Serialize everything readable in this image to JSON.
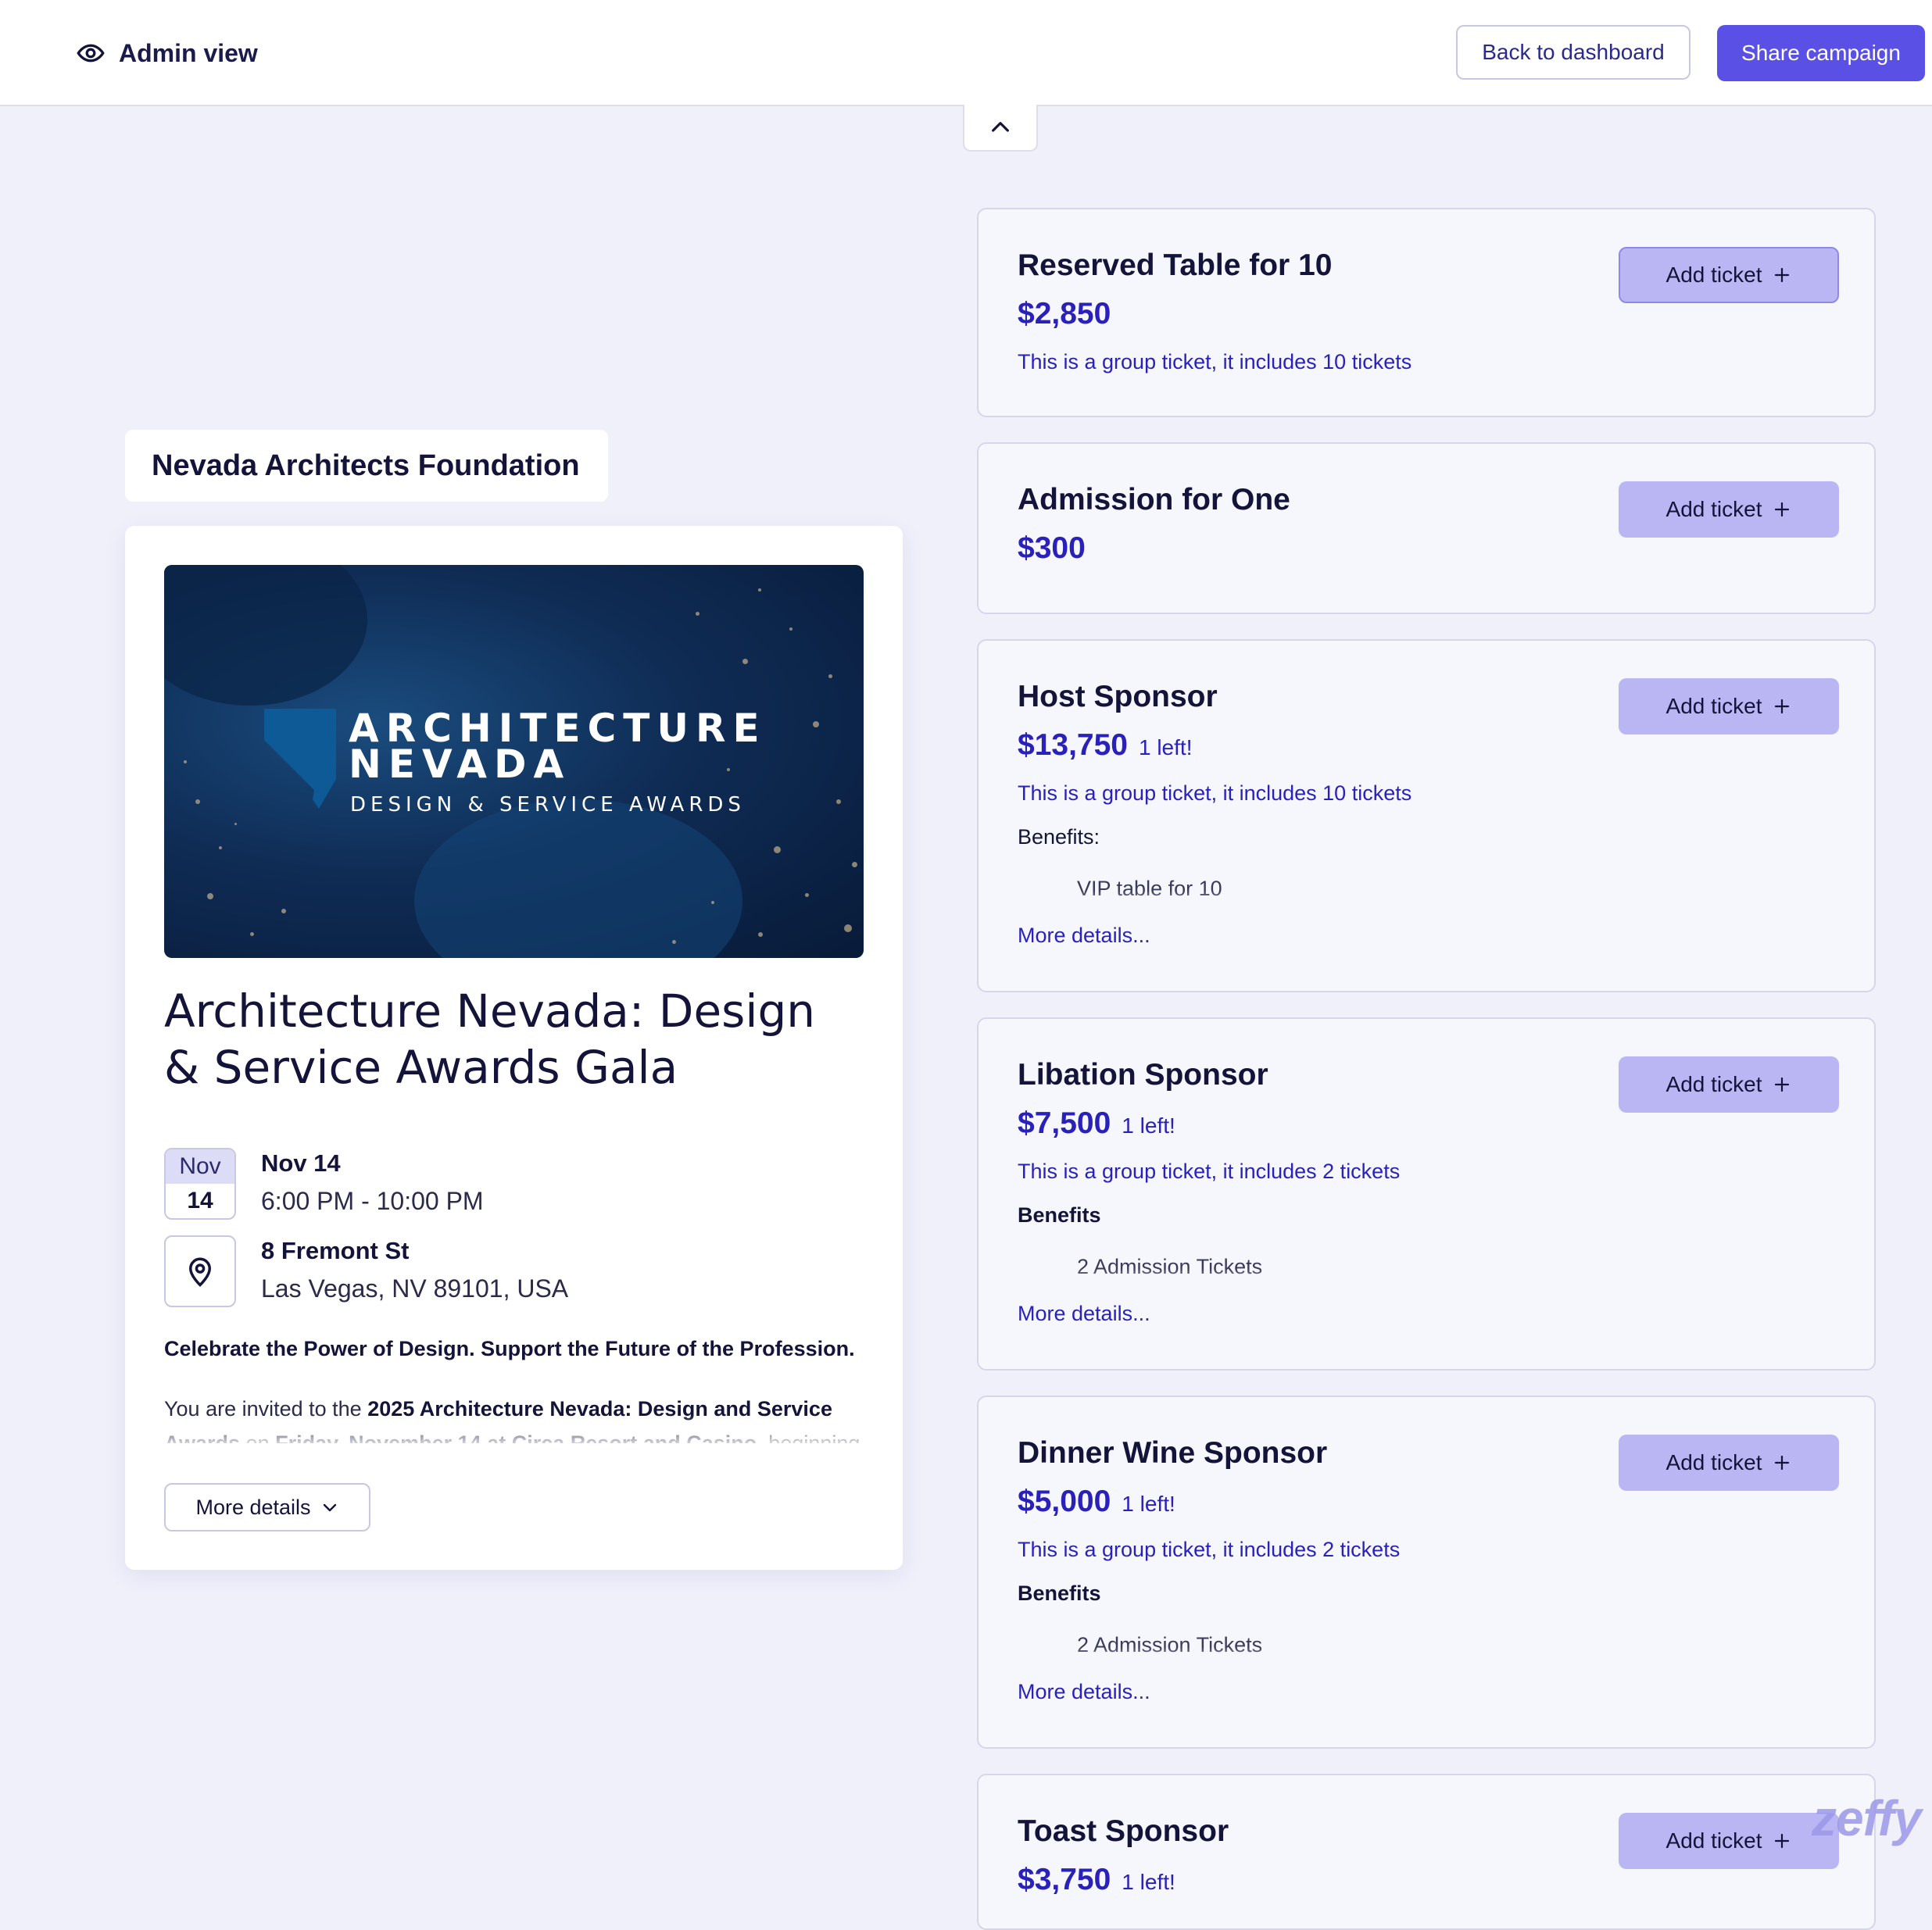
{
  "header": {
    "admin_label": "Admin view",
    "back_label": "Back to dashboard",
    "share_label": "Share campaign"
  },
  "organization": {
    "name": "Nevada Architects Foundation"
  },
  "event": {
    "banner": {
      "line1": "ARCHITECTURE",
      "line2": "NEVADA",
      "line3": "DESIGN & SERVICE AWARDS"
    },
    "title": "Architecture Nevada: Design & Service Awards Gala",
    "date_month": "Nov",
    "date_day": "14",
    "date_label": "Nov 14",
    "time_label": "6:00 PM - 10:00 PM",
    "address_line1": "8 Fremont St",
    "address_line2": "Las Vegas, NV 89101, USA",
    "tagline": "Celebrate the Power of Design. Support the Future of the Profession.",
    "description": {
      "t1": "You are invited to the ",
      "b1": "2025 Architecture Nevada: Design and Service Awards",
      "t2": " on ",
      "b2": "Friday, November 14 at Circa Resort and Casino",
      "t3": ", beginning"
    },
    "more_details_label": "More details"
  },
  "tickets": [
    {
      "name": "Reserved Table for 10",
      "price": "$2,850",
      "left": "",
      "note": "This is a group ticket, it includes 10 tickets",
      "add_label": "Add ticket"
    },
    {
      "name": "Admission for One",
      "price": "$300",
      "left": "",
      "note": "",
      "add_label": "Add ticket"
    },
    {
      "name": "Host Sponsor",
      "price": "$13,750",
      "left": "1 left!",
      "note": "This is a group ticket, it includes 10 tickets",
      "benefits_label": "Benefits:",
      "benefit": "VIP table for 10",
      "more": "More details...",
      "add_label": "Add ticket"
    },
    {
      "name": "Libation Sponsor",
      "price": "$7,500",
      "left": "1 left!",
      "note": "This is a group ticket, it includes 2 tickets",
      "benefits_label": "Benefits",
      "benefit": "2 Admission Tickets",
      "more": "More details...",
      "add_label": "Add ticket"
    },
    {
      "name": "Dinner Wine Sponsor",
      "price": "$5,000",
      "left": "1 left!",
      "note": "This is a group ticket, it includes 2 tickets",
      "benefits_label": "Benefits",
      "benefit": "2 Admission Tickets",
      "more": "More details...",
      "add_label": "Add ticket"
    },
    {
      "name": "Toast Sponsor",
      "price": "$3,750",
      "left": "1 left!",
      "add_label": "Add ticket"
    }
  ],
  "branding": {
    "watermark": "zeffy"
  },
  "icons": {
    "admin": "eye-icon",
    "collapse": "chevron-up-icon",
    "location": "map-pin-icon",
    "more": "chevron-down-icon",
    "add": "plus-icon"
  },
  "colors": {
    "page_bg": "#f0f0fb",
    "accent": "#5a50e6",
    "price": "#2a22b8",
    "add_button": "#b9b6f3"
  }
}
